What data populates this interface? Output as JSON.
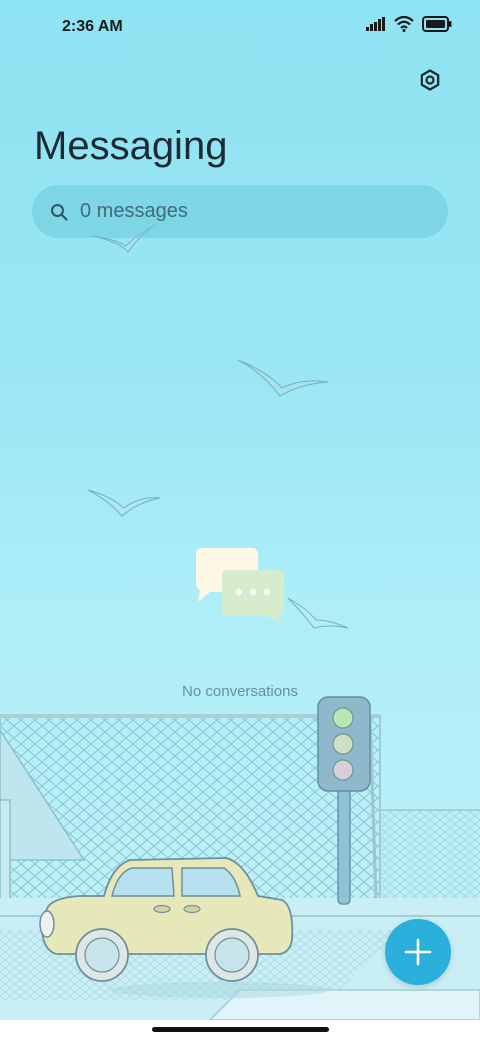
{
  "status_bar": {
    "time": "2:36 AM"
  },
  "header": {
    "title": "Messaging"
  },
  "search": {
    "text": "0 messages"
  },
  "empty_state": {
    "message": "No conversations"
  },
  "icons": {
    "settings": "gear-icon",
    "search": "search-icon",
    "fab": "plus-icon",
    "signal": "signal-icon",
    "wifi": "wifi-icon",
    "battery": "battery-icon"
  },
  "colors": {
    "accent": "#2bb0db",
    "background_top": "#8ee3f2",
    "background_bottom": "#c4f1f8"
  }
}
